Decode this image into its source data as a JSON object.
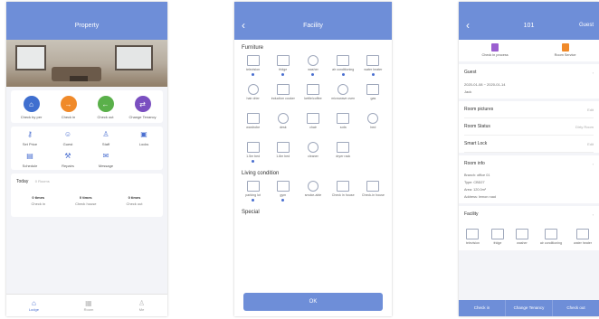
{
  "phone1": {
    "title": "Property",
    "quick_actions": [
      {
        "label": "Check by per",
        "color": "#3f6fcf",
        "icon": "home-icon"
      },
      {
        "label": "Check in",
        "color": "#f08a2a",
        "icon": "login-icon"
      },
      {
        "label": "Check out",
        "color": "#5ab04a",
        "icon": "logout-icon"
      },
      {
        "label": "Change Tenancy",
        "color": "#7a4fc0",
        "icon": "swap-icon"
      }
    ],
    "services": [
      {
        "label": "Set Price",
        "icon": "key-icon"
      },
      {
        "label": "Guest",
        "icon": "guest-icon"
      },
      {
        "label": "Staff",
        "icon": "staff-icon"
      },
      {
        "label": "Locks",
        "icon": "lock-icon"
      },
      {
        "label": "Schedule",
        "icon": "calendar-icon"
      },
      {
        "label": "Repairs",
        "icon": "wrench-icon"
      },
      {
        "label": "Message",
        "icon": "message-icon"
      }
    ],
    "today": {
      "label": "Today",
      "sub": "0 Rooms"
    },
    "stats": [
      {
        "value": "0 times",
        "label": "Check in"
      },
      {
        "value": "0 times",
        "label": "Check house"
      },
      {
        "value": "0 times",
        "label": "Check out"
      }
    ],
    "tabs": [
      {
        "label": "Lodge",
        "icon": "home-tab-icon",
        "active": true
      },
      {
        "label": "Room",
        "icon": "room-tab-icon",
        "active": false
      },
      {
        "label": "Me",
        "icon": "me-tab-icon",
        "active": false
      }
    ]
  },
  "phone2": {
    "title": "Facility",
    "furniture_label": "Furniture",
    "furniture": [
      {
        "label": "television",
        "on": true
      },
      {
        "label": "fridge",
        "on": true
      },
      {
        "label": "washer",
        "on": true
      },
      {
        "label": "air conditioning",
        "on": true
      },
      {
        "label": "water heater",
        "on": true
      },
      {
        "label": "hair drier",
        "on": false
      },
      {
        "label": "induction cooker",
        "on": false
      },
      {
        "label": "kettle/coffee",
        "on": false
      },
      {
        "label": "microwave oven",
        "on": false
      },
      {
        "label": "gas",
        "on": false
      },
      {
        "label": "wardrobe",
        "on": false
      },
      {
        "label": "desk",
        "on": false
      },
      {
        "label": "chair",
        "on": false
      },
      {
        "label": "sofa",
        "on": false
      },
      {
        "label": "bed",
        "on": false
      },
      {
        "label": "1.5m bed",
        "on": true
      },
      {
        "label": "1.8m bed",
        "on": false
      },
      {
        "label": "cleaner",
        "on": false
      },
      {
        "label": "dryer rack",
        "on": false
      }
    ],
    "living_label": "Living condition",
    "living": [
      {
        "label": "parking lot",
        "on": true
      },
      {
        "label": "gym",
        "on": true
      },
      {
        "label": "smoke-able",
        "on": false
      },
      {
        "label": "Check in house",
        "on": false
      },
      {
        "label": "Check-in house",
        "on": false
      }
    ],
    "special_label": "Special",
    "ok_label": "OK"
  },
  "phone3": {
    "title": "101",
    "right_label": "Guest",
    "top_actions": [
      {
        "label": "Check in process",
        "color": "#9b5fd0",
        "icon": "checkin-icon"
      },
      {
        "label": "Room Service",
        "color": "#f08a2a",
        "icon": "service-icon"
      }
    ],
    "guest_label": "Guest",
    "guest_dates": "2020-01-08 ~ 2020-01-14",
    "guest_name": "Jack",
    "rows": [
      {
        "label": "Room pictures",
        "value": "Edit"
      },
      {
        "label": "Room Status",
        "value": "Dirty Room"
      },
      {
        "label": "Smart Lock",
        "value": "Edit"
      }
    ],
    "room_info_label": "Room info",
    "room_info": [
      "Branch: office 01",
      "Type: CBD27",
      "Area: 120.0m²",
      "Address: lemon road"
    ],
    "facility_label": "Facility",
    "facility_items": [
      "television",
      "fridge",
      "washer",
      "air conditioning",
      "water heater"
    ],
    "bottom_buttons": [
      "Check in",
      "Change Tenancy",
      "Check out"
    ]
  }
}
